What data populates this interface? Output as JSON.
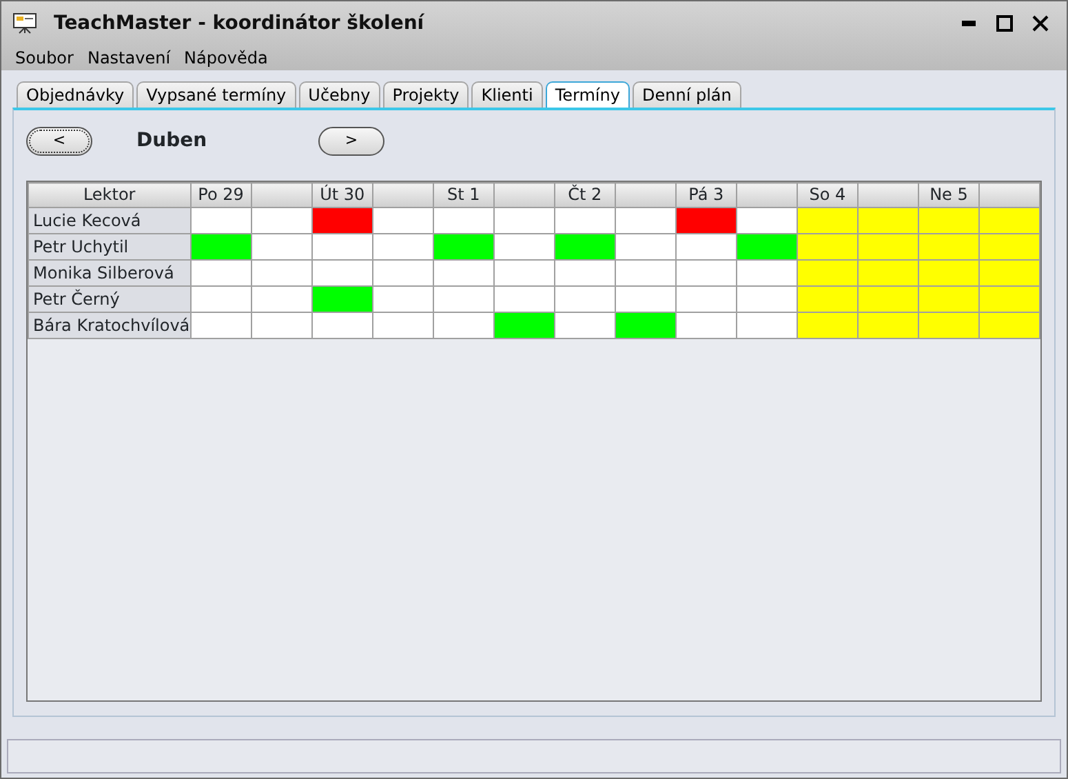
{
  "window": {
    "title": "TeachMaster - koordinátor školení"
  },
  "menu": [
    "Soubor",
    "Nastavení",
    "Nápověda"
  ],
  "tabs": [
    {
      "label": "Objednávky",
      "selected": false
    },
    {
      "label": "Vypsané termíny",
      "selected": false
    },
    {
      "label": "Učebny",
      "selected": false
    },
    {
      "label": "Projekty",
      "selected": false
    },
    {
      "label": "Klienti",
      "selected": false
    },
    {
      "label": "Termíny",
      "selected": true
    },
    {
      "label": "Denní plán",
      "selected": false
    }
  ],
  "navigation": {
    "previous": "<",
    "month": "Duben",
    "next": ">"
  },
  "table": {
    "corner": "Lektor",
    "days": [
      "Po 29",
      "Út 30",
      "St 1",
      "Čt 2",
      "Pá 3",
      "So 4",
      "Ne 5"
    ],
    "rows": [
      {
        "name": "Lucie Kecová",
        "cells": [
          {
            "color": "#ffffff"
          },
          {
            "color": "#ffffff"
          },
          {
            "color": "#ff0000"
          },
          {
            "color": "#ffffff"
          },
          {
            "color": "#ffffff"
          },
          {
            "color": "#ffffff"
          },
          {
            "color": "#ffffff"
          },
          {
            "color": "#ffffff"
          },
          {
            "color": "#ff0000"
          },
          {
            "color": "#ffffff"
          },
          {
            "color": "#ffff00"
          },
          {
            "color": "#ffff00"
          },
          {
            "color": "#ffff00"
          },
          {
            "color": "#ffff00"
          }
        ]
      },
      {
        "name": "Petr Uchytil",
        "cells": [
          {
            "color": "#00ff00"
          },
          {
            "color": "#ffffff"
          },
          {
            "color": "#ffffff"
          },
          {
            "color": "#ffffff"
          },
          {
            "color": "#00ff00"
          },
          {
            "color": "#ffffff"
          },
          {
            "color": "#00ff00"
          },
          {
            "color": "#ffffff"
          },
          {
            "color": "#ffffff"
          },
          {
            "color": "#00ff00"
          },
          {
            "color": "#ffff00"
          },
          {
            "color": "#ffff00"
          },
          {
            "color": "#ffff00"
          },
          {
            "color": "#ffff00"
          }
        ]
      },
      {
        "name": "Monika Silberová",
        "cells": [
          {
            "color": "#ffffff"
          },
          {
            "color": "#ffffff"
          },
          {
            "color": "#ffffff"
          },
          {
            "color": "#ffffff"
          },
          {
            "color": "#ffffff"
          },
          {
            "color": "#ffffff"
          },
          {
            "color": "#ffffff"
          },
          {
            "color": "#ffffff"
          },
          {
            "color": "#ffffff"
          },
          {
            "color": "#ffffff"
          },
          {
            "color": "#ffff00"
          },
          {
            "color": "#ffff00"
          },
          {
            "color": "#ffff00"
          },
          {
            "color": "#ffff00"
          }
        ]
      },
      {
        "name": "Petr Černý",
        "cells": [
          {
            "color": "#ffffff"
          },
          {
            "color": "#ffffff"
          },
          {
            "color": "#00ff00"
          },
          {
            "color": "#ffffff"
          },
          {
            "color": "#ffffff"
          },
          {
            "color": "#ffffff"
          },
          {
            "color": "#ffffff"
          },
          {
            "color": "#ffffff"
          },
          {
            "color": "#ffffff"
          },
          {
            "color": "#ffffff"
          },
          {
            "color": "#ffff00"
          },
          {
            "color": "#ffff00"
          },
          {
            "color": "#ffff00"
          },
          {
            "color": "#ffff00"
          }
        ]
      },
      {
        "name": "Bára Kratochvílová",
        "cells": [
          {
            "color": "#ffffff"
          },
          {
            "color": "#ffffff"
          },
          {
            "color": "#ffffff"
          },
          {
            "color": "#ffffff"
          },
          {
            "color": "#ffffff"
          },
          {
            "color": "#00ff00"
          },
          {
            "color": "#ffffff"
          },
          {
            "color": "#00ff00"
          },
          {
            "color": "#ffffff"
          },
          {
            "color": "#ffffff"
          },
          {
            "color": "#ffff00"
          },
          {
            "color": "#ffff00"
          },
          {
            "color": "#ffff00"
          },
          {
            "color": "#ffff00"
          }
        ]
      }
    ]
  }
}
